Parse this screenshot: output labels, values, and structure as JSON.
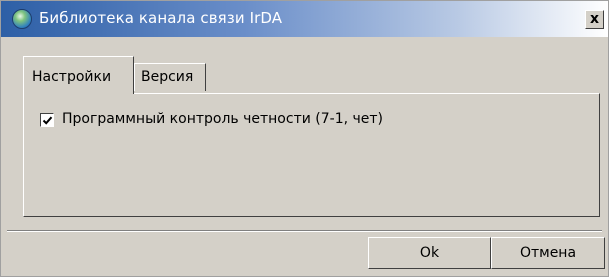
{
  "window": {
    "title": "Библиотека канала связи IrDA",
    "icon": "app-globe-icon",
    "close_symbol": "x"
  },
  "tabs": [
    {
      "label": "Настройки",
      "active": true
    },
    {
      "label": "Версия",
      "active": false
    }
  ],
  "settings": {
    "checkbox_label": "Программный контроль четности (7-1, чет)",
    "checkbox_checked": true
  },
  "buttons": {
    "ok_label": "Ok",
    "cancel_label": "Отмена"
  }
}
